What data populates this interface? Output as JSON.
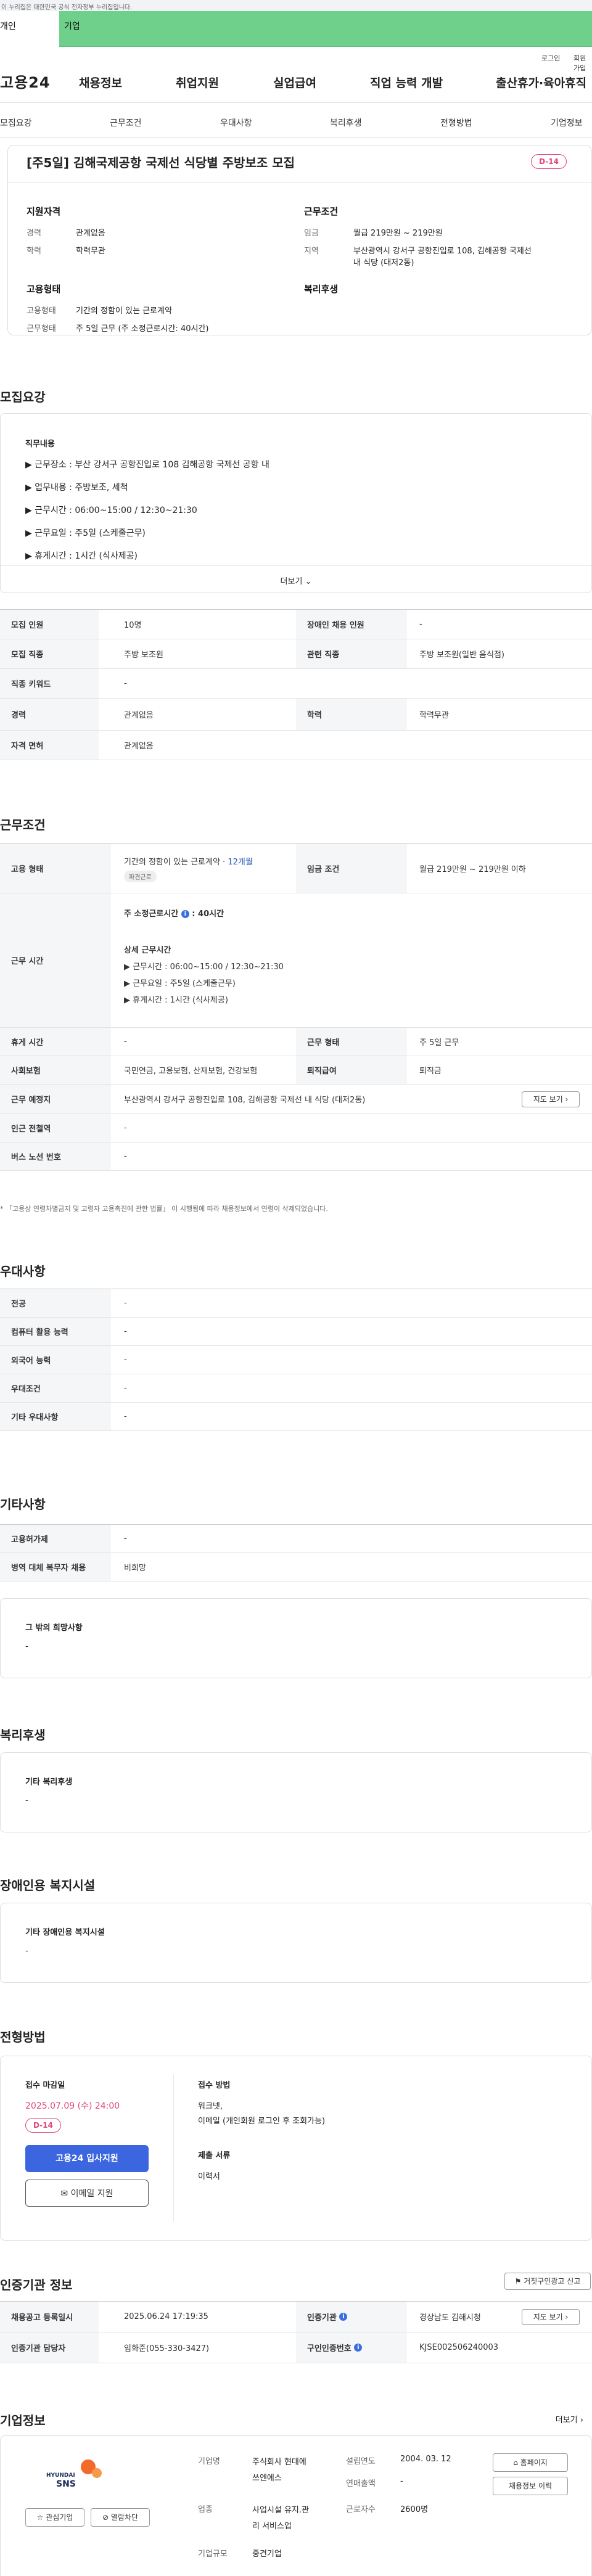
{
  "topbar": {
    "notice": "이 누리집은 대한민국 공식 전자정부 누리집입니다."
  },
  "member_tabs": {
    "individual": "개인",
    "corporate": "기업"
  },
  "util": {
    "login": "로그인",
    "signup": "회원가입"
  },
  "header": {
    "logo": "고용24",
    "nav": [
      "채용정보",
      "취업지원",
      "실업급여",
      "직업 능력 개발",
      "출산휴가·육아휴직"
    ]
  },
  "subnav": [
    "모집요강",
    "근무조건",
    "우대사항",
    "복리후생",
    "전형방법",
    "기업정보"
  ],
  "title_card": {
    "title": "[주5일] 김해국제공항 국제선 식당별 주방보조 모집",
    "dday": "D-14",
    "qualification_head": "지원자격",
    "career_k": "경력",
    "career_v": "관계없음",
    "edu_k": "학력",
    "edu_v": "학력무관",
    "conditions_head": "근무조건",
    "wage_k": "임금",
    "wage_v": "월급 219만원 ~ 219만원",
    "region_k": "지역",
    "region_v1": "부산광역시 강서구 공항진입로 108, 김해공항 국제선",
    "region_v2": "내 식당 (대저2동)",
    "employment_head": "고용형태",
    "emp_type_k": "고용형태",
    "emp_type_v": "기간의 정함이 있는 근로계약",
    "work_type_k": "근무형태",
    "work_type_v": "주 5일 근무 (주 소정근로시간: 40시간)",
    "welfare_head": "복리후생"
  },
  "recruit": {
    "title": "모집요강",
    "duty_head": "직무내용",
    "lines": [
      "▶ 근무장소 : 부산 강서구 공항진입로 108 김해공항 국제선 공항 내",
      "▶ 업무내용 : 주방보조, 세척",
      "▶ 근무시간 : 06:00~15:00 / 12:30~21:30",
      "▶ 근무요일 : 주5일 (스케줄근무)",
      "▶ 휴게시간 : 1시간 (식사제공)"
    ],
    "more": "더보기"
  },
  "recruit_table": [
    {
      "k1": "모집 인원",
      "v1": "10명",
      "k2": "장애인 채용 인원",
      "v2": "-"
    },
    {
      "k1": "모집 직종",
      "v1": "주방 보조원",
      "k2": "관련 직종",
      "v2": "주방 보조원(일반 음식점)"
    },
    {
      "k1": "직종 키워드",
      "v1": "-"
    },
    {
      "k1": "경력",
      "v1": "관계없음",
      "k2": "학력",
      "v2": "학력무관"
    },
    {
      "k1": "자격 면허",
      "v1": "관계없음"
    }
  ],
  "conditions": {
    "title": "근무조건",
    "emp_type_k": "고용 형태",
    "emp_type_v": "기간의 정함이 있는 근로계약",
    "emp_months": "12개월",
    "emp_badge": "파견근로",
    "wage_k": "임금 조건",
    "wage_v": "월급 219만원 ~ 219만원 이하",
    "hours_k": "근무 시간",
    "hours_weekly": "주 소정근로시간",
    "hours_weekly_v": "40시간",
    "hours_detail_head": "상세 근무시간",
    "hours_lines": [
      "▶ 근무시간 : 06:00~15:00 / 12:30~21:30",
      "▶ 근무요일 : 주5일 (스케줄근무)",
      "▶ 휴게시간 : 1시간 (식사제공)"
    ],
    "break_k": "휴게 시간",
    "break_v": "-",
    "worktype_k": "근무 형태",
    "worktype_v": "주 5일 근무",
    "insurance_k": "사회보험",
    "insurance_v": "국민연금, 고용보험, 산재보험, 건강보험",
    "severance_k": "퇴직급여",
    "severance_v": "퇴직금",
    "location_k": "근무 예정지",
    "location_v": "부산광역시 강서구 공항진입로 108, 김해공항 국제선 내 식당 (대저2동)",
    "map_btn": "지도 보기",
    "station_k": "인근 전철역",
    "station_v": "-",
    "bus_k": "버스 노선 번호",
    "bus_v": "-",
    "note": "* 「고용상 연령차별금지 및 고령자 고용촉진에 관한 법률」 이 시행됨에 따라 채용정보에서 연령이 삭제되었습니다."
  },
  "preference": {
    "title": "우대사항",
    "rows": [
      {
        "k": "전공",
        "v": "-"
      },
      {
        "k": "컴퓨터 활용 능력",
        "v": "-"
      },
      {
        "k": "외국어 능력",
        "v": "-"
      },
      {
        "k": "우대조건",
        "v": "-"
      },
      {
        "k": "기타 우대사항",
        "v": "-"
      }
    ]
  },
  "other": {
    "title": "기타사항",
    "rows": [
      {
        "k": "고용허가제",
        "v": "-"
      },
      {
        "k": "병역 대체 복무자 채용",
        "v": "비희망"
      }
    ],
    "extra_head": "그 밖의 희망사항",
    "extra_v": "-"
  },
  "welfare": {
    "title": "복리후생",
    "head": "기타 복리후생",
    "v": "-"
  },
  "disability": {
    "title": "장애인용 복지시설",
    "head": "기타 장애인용 복지시설",
    "v": "-"
  },
  "selection": {
    "title": "전형방법",
    "deadline_head": "접수 마감일",
    "deadline_v": "2025.07.09 (수) 24:00",
    "dday": "D-14",
    "apply_btn": "고용24 입사지원",
    "email_btn": "이메일 지원",
    "method_head": "접수 방법",
    "method_v1": "워크넷,",
    "method_v2": "이메일 (개인회원 로그인 후 조회가능)",
    "docs_head": "제출 서류",
    "docs_v": "이력서"
  },
  "cert": {
    "title": "인증기관 정보",
    "report_btn": "거짓구인광고 신고",
    "reg_k": "채용공고 등록일시",
    "reg_v": "2025.06.24 17:19:35",
    "agency_k": "인증기관",
    "agency_v": "경상남도 김해시청",
    "map_btn": "지도 보기",
    "manager_k": "인증기관 담당자",
    "manager_v": "임화준(055-330-3427)",
    "id_k": "구인인증번호",
    "id_v": "KJSE002506240003"
  },
  "company": {
    "title": "기업정보",
    "more": "더보기",
    "logo_text": "HYUNDAI SNS",
    "name_k": "기업명",
    "name_v1": "주식회사 현대에",
    "name_v2": "쓰엔에스",
    "founded_k": "설립연도",
    "founded_v": "2004. 03. 12",
    "homepage_btn": "홈페이지",
    "sales_k": "연매출액",
    "sales_v": "-",
    "jobinfo_btn": "채용정보 이력",
    "industry_k": "업종",
    "industry_v1": "사업시설 유지.관",
    "industry_v2": "리 서비스업",
    "employees_k": "근로자수",
    "employees_v": "2600명",
    "size_k": "기업규모",
    "size_v": "중견기업",
    "interest_btn": "관심기업",
    "block_btn": "열람차단"
  },
  "colors": {
    "green": "#6fd08b",
    "accent_red": "#e0457b",
    "blue": "#3b66e0"
  }
}
